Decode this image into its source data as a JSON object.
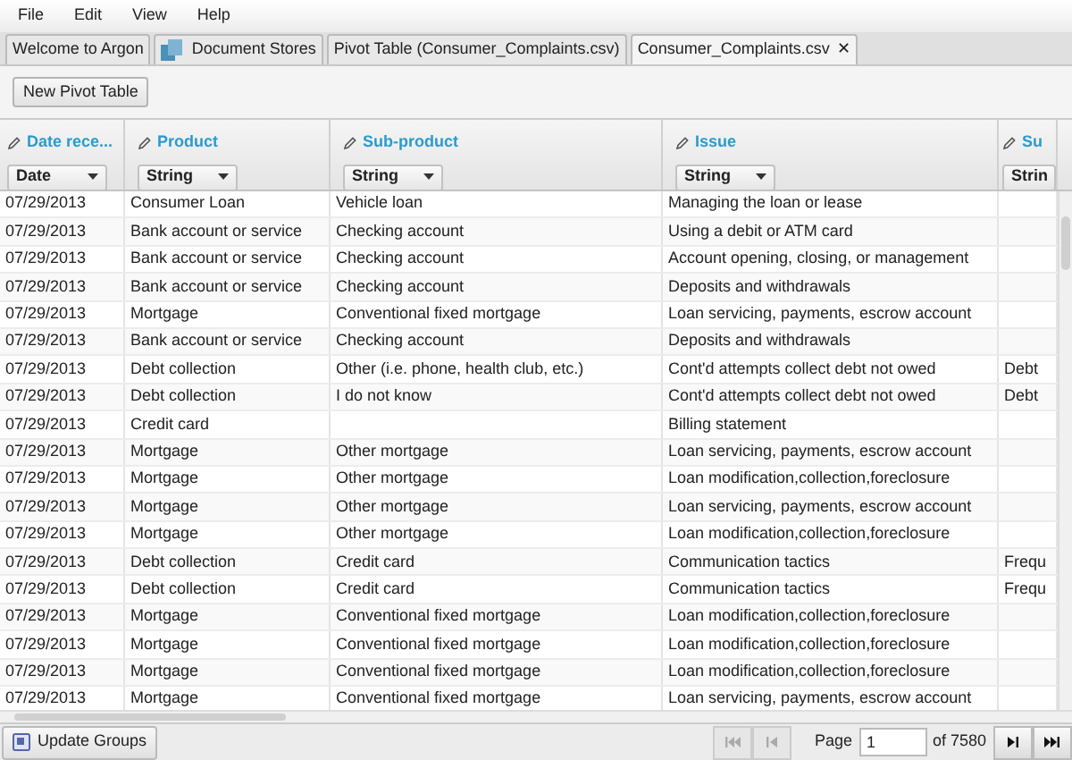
{
  "menu": [
    "File",
    "Edit",
    "View",
    "Help"
  ],
  "tabs": [
    {
      "label": "Welcome to Argon",
      "selected": false,
      "icon": false,
      "closable": false
    },
    {
      "label": "Document Stores",
      "selected": false,
      "icon": true,
      "closable": false
    },
    {
      "label": "Pivot Table (Consumer_Complaints.csv)",
      "selected": false,
      "icon": false,
      "closable": false
    },
    {
      "label": "Consumer_Complaints.csv",
      "selected": true,
      "icon": false,
      "closable": true,
      "close": "✕"
    }
  ],
  "toolbar": {
    "button": "New Pivot Table"
  },
  "table": {
    "columns": [
      {
        "name": "Date rece...",
        "type": "Date"
      },
      {
        "name": "Product",
        "type": "String"
      },
      {
        "name": "Sub-product",
        "type": "String"
      },
      {
        "name": "Issue",
        "type": "String"
      },
      {
        "name": "Su",
        "type": "Strin"
      }
    ],
    "rows": [
      [
        "07/29/2013",
        "Consumer Loan",
        "Vehicle loan",
        "Managing the loan or lease",
        ""
      ],
      [
        "07/29/2013",
        "Bank account or service",
        "Checking account",
        "Using a debit or ATM card",
        ""
      ],
      [
        "07/29/2013",
        "Bank account or service",
        "Checking account",
        "Account opening, closing, or management",
        ""
      ],
      [
        "07/29/2013",
        "Bank account or service",
        "Checking account",
        "Deposits and withdrawals",
        ""
      ],
      [
        "07/29/2013",
        "Mortgage",
        "Conventional fixed mortgage",
        "Loan servicing, payments, escrow account",
        ""
      ],
      [
        "07/29/2013",
        "Bank account or service",
        "Checking account",
        "Deposits and withdrawals",
        ""
      ],
      [
        "07/29/2013",
        "Debt collection",
        "Other (i.e. phone, health club, etc.)",
        "Cont'd attempts collect debt not owed",
        "Debt"
      ],
      [
        "07/29/2013",
        "Debt collection",
        "I do not know",
        "Cont'd attempts collect debt not owed",
        "Debt"
      ],
      [
        "07/29/2013",
        "Credit card",
        "",
        "Billing statement",
        ""
      ],
      [
        "07/29/2013",
        "Mortgage",
        "Other mortgage",
        "Loan servicing, payments, escrow account",
        ""
      ],
      [
        "07/29/2013",
        "Mortgage",
        "Other mortgage",
        "Loan modification,collection,foreclosure",
        ""
      ],
      [
        "07/29/2013",
        "Mortgage",
        "Other mortgage",
        "Loan servicing, payments, escrow account",
        ""
      ],
      [
        "07/29/2013",
        "Mortgage",
        "Other mortgage",
        "Loan modification,collection,foreclosure",
        ""
      ],
      [
        "07/29/2013",
        "Debt collection",
        "Credit card",
        "Communication tactics",
        "Frequ"
      ],
      [
        "07/29/2013",
        "Debt collection",
        "Credit card",
        "Communication tactics",
        "Frequ"
      ],
      [
        "07/29/2013",
        "Mortgage",
        "Conventional fixed mortgage",
        "Loan modification,collection,foreclosure",
        ""
      ],
      [
        "07/29/2013",
        "Mortgage",
        "Conventional fixed mortgage",
        "Loan modification,collection,foreclosure",
        ""
      ],
      [
        "07/29/2013",
        "Mortgage",
        "Conventional fixed mortgage",
        "Loan modification,collection,foreclosure",
        ""
      ],
      [
        "07/29/2013",
        "Mortgage",
        "Conventional fixed mortgage",
        "Loan servicing, payments, escrow account",
        ""
      ]
    ]
  },
  "footer": {
    "update_button": "Update Groups",
    "page_label": "Page",
    "page_value": "1",
    "page_total": "of 7580",
    "nav": [
      {
        "kind": "first",
        "disabled": true
      },
      {
        "kind": "prev",
        "disabled": true
      },
      {
        "kind": "next",
        "disabled": false
      },
      {
        "kind": "last",
        "disabled": false
      }
    ]
  }
}
